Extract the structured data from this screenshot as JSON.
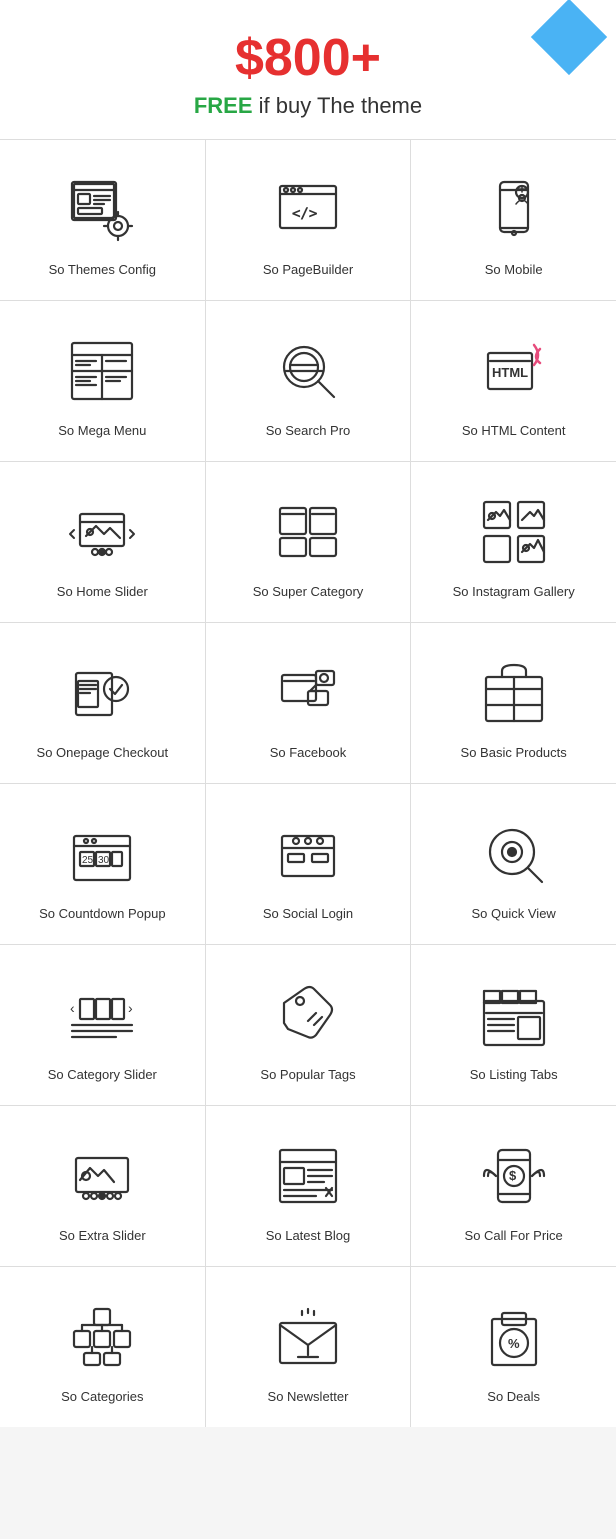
{
  "header": {
    "price": "$800+",
    "subtitle_free": "FREE",
    "subtitle_rest": " if buy The theme"
  },
  "grid_items": [
    {
      "id": "themes-config",
      "label": "So Themes Config",
      "icon": "themes-config"
    },
    {
      "id": "pagebuilder",
      "label": "So PageBuilder",
      "icon": "pagebuilder"
    },
    {
      "id": "mobile",
      "label": "So Mobile",
      "icon": "mobile"
    },
    {
      "id": "mega-menu",
      "label": "So Mega Menu",
      "icon": "mega-menu"
    },
    {
      "id": "search-pro",
      "label": "So Search Pro",
      "icon": "search-pro"
    },
    {
      "id": "html-content",
      "label": "So HTML Content",
      "icon": "html-content"
    },
    {
      "id": "home-slider",
      "label": "So Home Slider",
      "icon": "home-slider"
    },
    {
      "id": "super-category",
      "label": "So Super Category",
      "icon": "super-category"
    },
    {
      "id": "instagram-gallery",
      "label": "So Instagram Gallery",
      "icon": "instagram-gallery"
    },
    {
      "id": "onepage-checkout",
      "label": "So Onepage Checkout",
      "icon": "onepage-checkout"
    },
    {
      "id": "facebook",
      "label": "So Facebook",
      "icon": "facebook"
    },
    {
      "id": "basic-products",
      "label": "So Basic Products",
      "icon": "basic-products"
    },
    {
      "id": "countdown-popup",
      "label": "So Countdown Popup",
      "icon": "countdown-popup"
    },
    {
      "id": "social-login",
      "label": "So Social Login",
      "icon": "social-login"
    },
    {
      "id": "quick-view",
      "label": "So Quick View",
      "icon": "quick-view"
    },
    {
      "id": "category-slider",
      "label": "So Category Slider",
      "icon": "category-slider"
    },
    {
      "id": "popular-tags",
      "label": "So Popular Tags",
      "icon": "popular-tags"
    },
    {
      "id": "listing-tabs",
      "label": "So Listing Tabs",
      "icon": "listing-tabs"
    },
    {
      "id": "extra-slider",
      "label": "So Extra Slider",
      "icon": "extra-slider"
    },
    {
      "id": "latest-blog",
      "label": "So Latest Blog",
      "icon": "latest-blog"
    },
    {
      "id": "call-for-price",
      "label": "So Call For Price",
      "icon": "call-for-price"
    },
    {
      "id": "categories",
      "label": "So Categories",
      "icon": "categories"
    },
    {
      "id": "newsletter",
      "label": "So Newsletter",
      "icon": "newsletter"
    },
    {
      "id": "deals",
      "label": "So Deals",
      "icon": "deals"
    }
  ]
}
